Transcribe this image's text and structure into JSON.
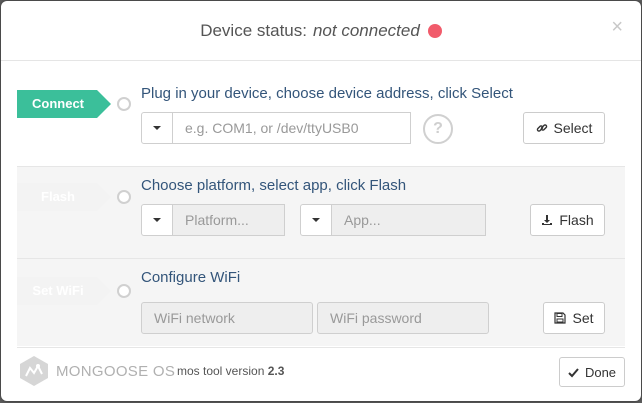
{
  "header": {
    "title_prefix": "Device status:",
    "status_text": "not connected",
    "status_color": "#f15b6b",
    "close_label": "×"
  },
  "steps": [
    {
      "tag": "Connect",
      "title": "Plug in your device, choose device address, click Select",
      "address_placeholder": "e.g. COM1, or /dev/ttyUSB0",
      "help_label": "?",
      "button_label": "Select",
      "button_icon": "link-icon"
    },
    {
      "tag": "Flash",
      "title": "Choose platform, select app, click Flash",
      "platform_placeholder": "Platform...",
      "app_placeholder": "App...",
      "button_label": "Flash",
      "button_icon": "download-icon"
    },
    {
      "tag": "Set WiFi",
      "title": "Configure WiFi",
      "network_placeholder": "WiFi network",
      "password_placeholder": "WiFi password",
      "button_label": "Set",
      "button_icon": "save-icon"
    }
  ],
  "footer": {
    "logo_text": "MONGOOSE OS",
    "version_prefix": "mos tool version",
    "version_number": "2.3",
    "done_label": "Done"
  },
  "colors": {
    "accent": "#3bbf9a",
    "title_blue": "#33557a"
  }
}
